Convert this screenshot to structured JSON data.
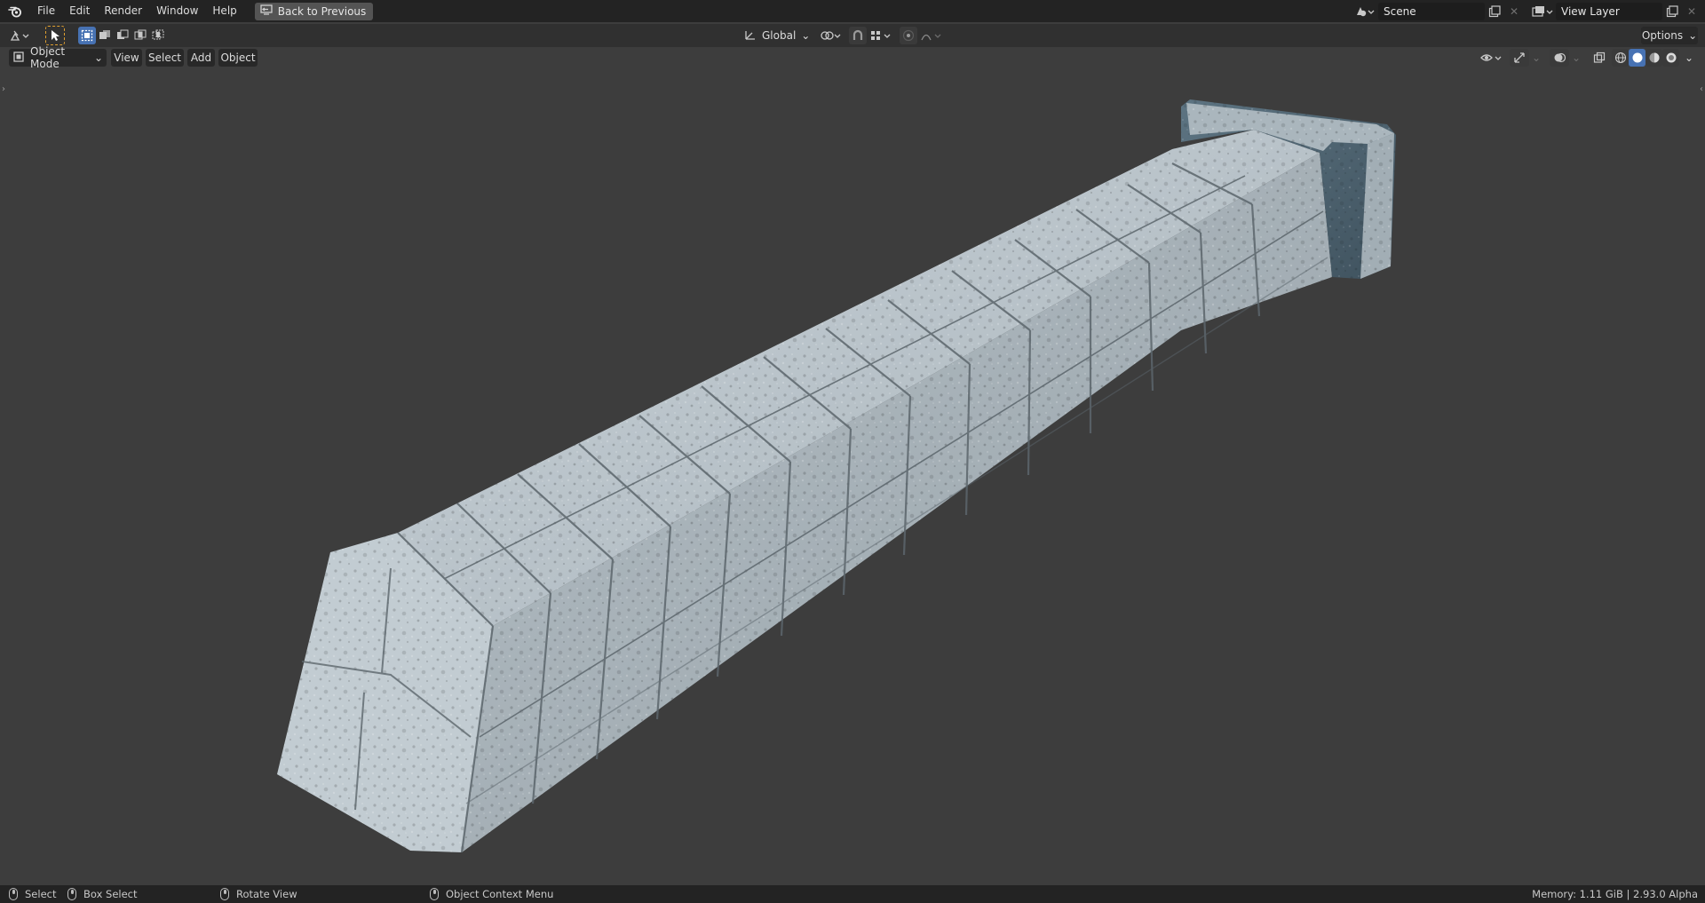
{
  "menu": {
    "file": "File",
    "edit": "Edit",
    "render": "Render",
    "window": "Window",
    "help": "Help",
    "back_to_previous": "Back to Previous"
  },
  "scene": {
    "name": "Scene"
  },
  "view_layer": {
    "name": "View Layer"
  },
  "tool_header": {
    "orientation": "Global",
    "options": "Options"
  },
  "view_header": {
    "mode": "Object Mode",
    "view": "View",
    "select": "Select",
    "add": "Add",
    "object": "Object"
  },
  "status": {
    "select": "Select",
    "box_select": "Box Select",
    "rotate_view": "Rotate View",
    "context_menu": "Object Context Menu",
    "memory": "Memory: 1.11 GiB | 2.93.0 Alpha"
  },
  "colors": {
    "background": "#3d3d3d",
    "topbar": "#232323",
    "accent": "#4772b3",
    "stone": "#b8c2c8",
    "frame": "#4f6472"
  },
  "icons": [
    "blender-logo-icon",
    "back-icon",
    "select-cursor-icon",
    "box-select-mode-icons",
    "transform-orientation-icon",
    "pivot-icon",
    "snap-icon",
    "proportional-editing-icon",
    "visibility-icon",
    "gizmo-icon",
    "overlay-icon",
    "xray-icon",
    "shading-wireframe-icon",
    "shading-solid-icon",
    "shading-material-icon",
    "shading-rendered-icon",
    "mouse-icon"
  ]
}
